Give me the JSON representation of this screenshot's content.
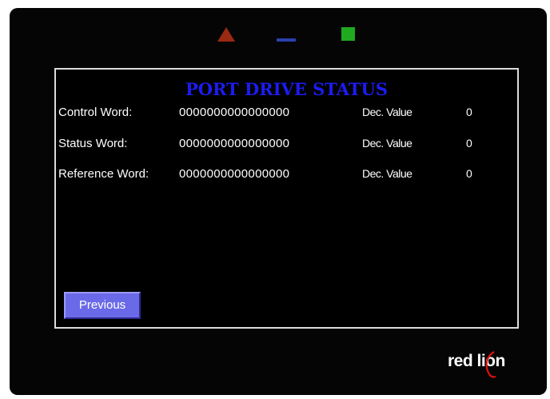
{
  "indicators": {
    "red": "#9a2a12",
    "blue": "#2a3fae",
    "green": "#1faa1f"
  },
  "screen": {
    "title": "PORT DRIVE STATUS",
    "title_color": "#1c1cf0",
    "rows": [
      {
        "label": "Control Word:",
        "bits": "0000000000000000",
        "dec_label": "Dec. Value",
        "dec_value": "0"
      },
      {
        "label": "Status Word:",
        "bits": "0000000000000000",
        "dec_label": "Dec. Value",
        "dec_value": "0"
      },
      {
        "label": "Reference Word:",
        "bits": "0000000000000000",
        "dec_label": "Dec. Value",
        "dec_value": "0"
      }
    ],
    "previous_button": "Previous",
    "button_color": "#6a6ae8"
  },
  "logo": {
    "text": "red lion",
    "accent_color": "#e01010"
  }
}
